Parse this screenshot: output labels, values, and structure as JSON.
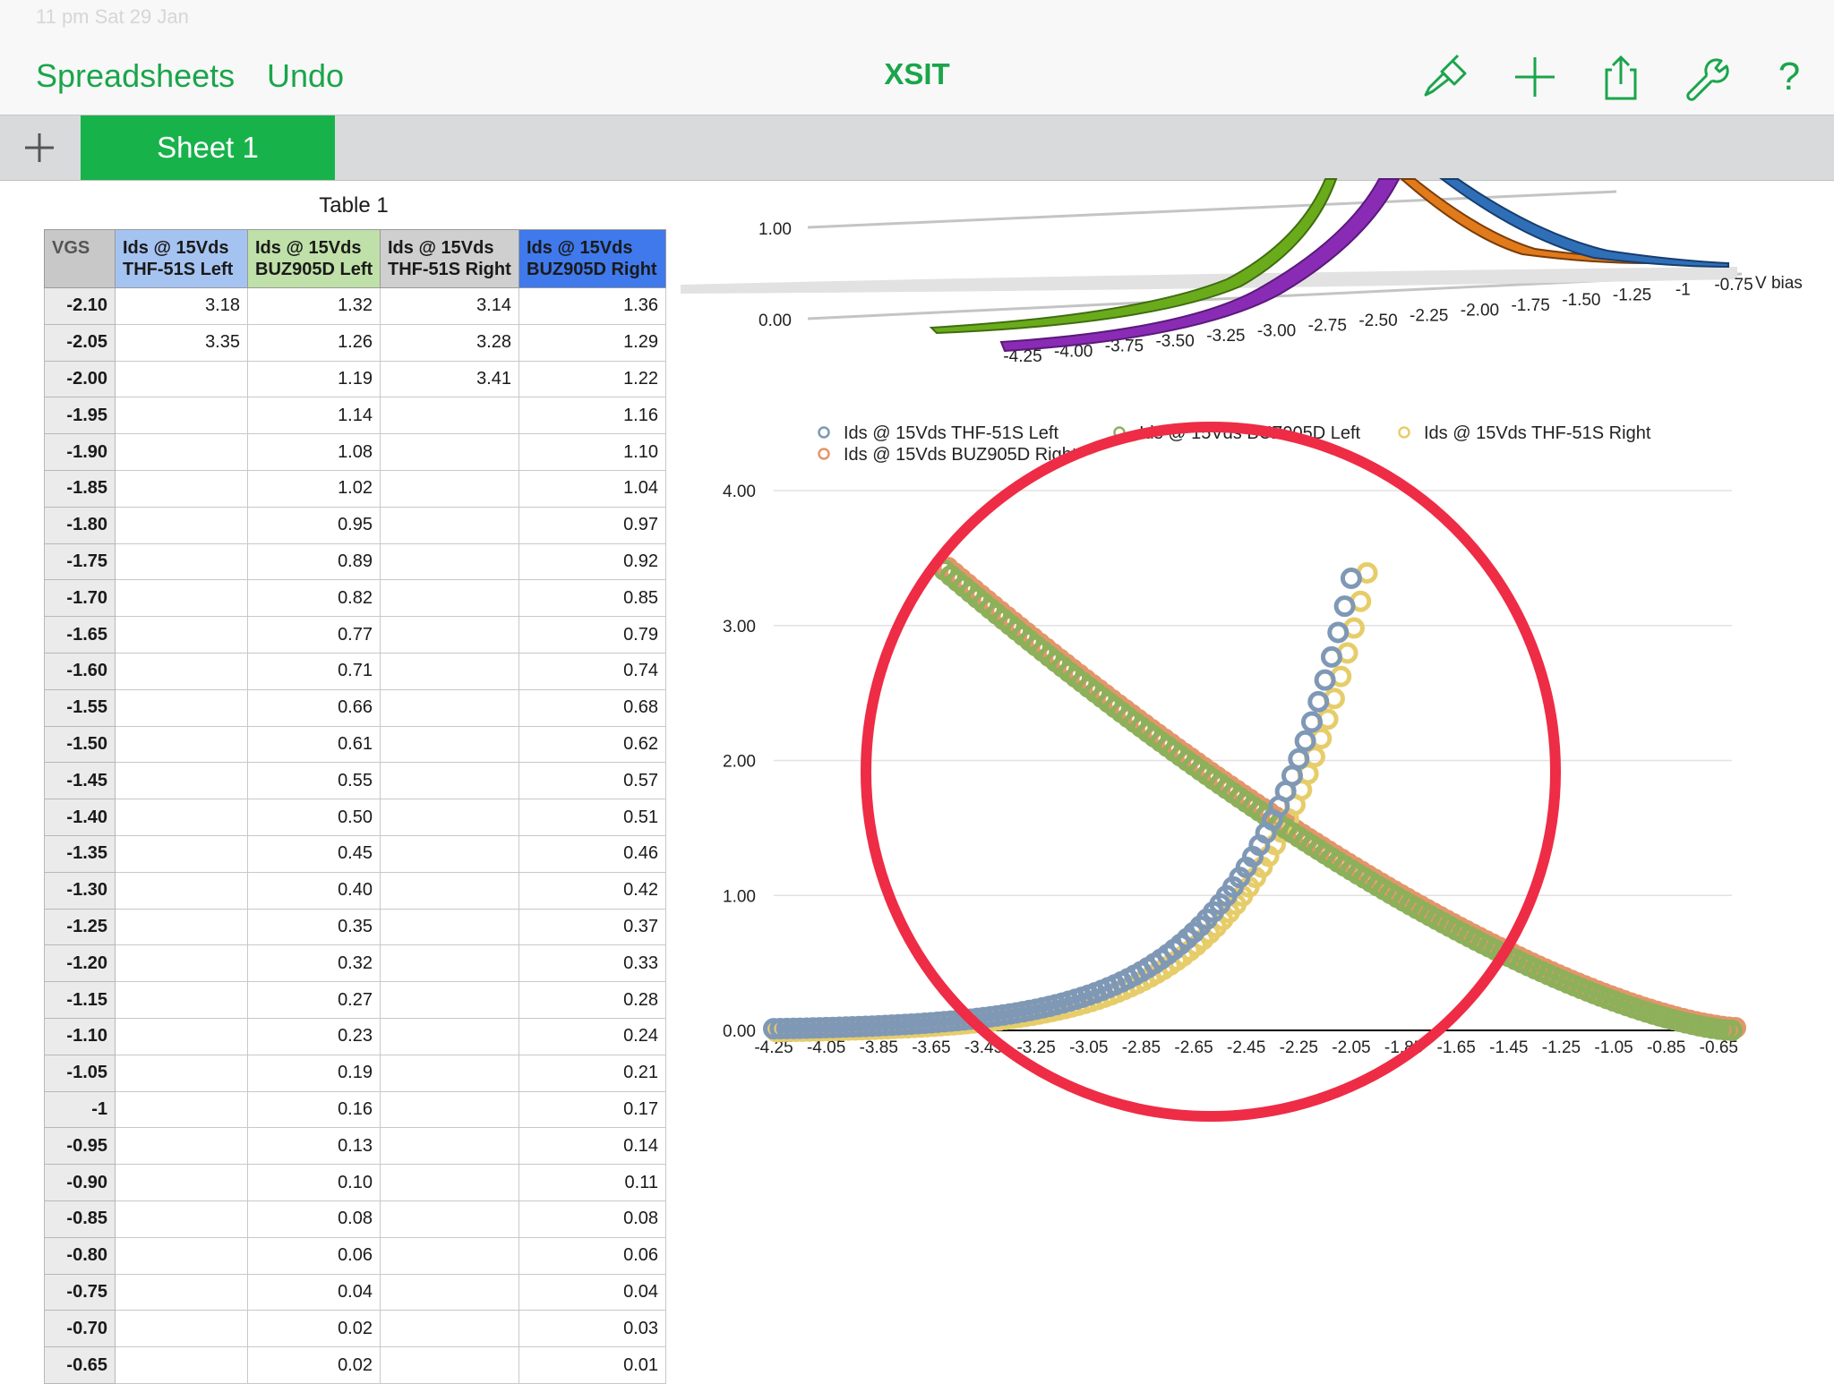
{
  "status": {
    "left_text": "11 pm  Sat 29 Jan"
  },
  "nav": {
    "back_label": "Spreadsheets",
    "undo_label": "Undo",
    "title": "XSIT",
    "icons": [
      "paintbrush-icon",
      "plus-icon",
      "share-icon",
      "wrench-icon",
      "help-icon"
    ],
    "help_glyph": "?"
  },
  "tabs": {
    "add_glyph": "+",
    "active_label": "Sheet 1"
  },
  "table": {
    "title": "Table 1",
    "headers": [
      {
        "line1": "VGS",
        "line2": ""
      },
      {
        "line1": "Ids @ 15Vds",
        "line2": "THF-51S Left"
      },
      {
        "line1": "Ids @ 15Vds",
        "line2": "BUZ905D Left"
      },
      {
        "line1": "Ids @ 15Vds",
        "line2": "THF-51S Right"
      },
      {
        "line1": "Ids @ 15Vds",
        "line2": "BUZ905D Right"
      }
    ],
    "rows": [
      [
        "-2.10",
        "3.18",
        "1.32",
        "3.14",
        "1.36"
      ],
      [
        "-2.05",
        "3.35",
        "1.26",
        "3.28",
        "1.29"
      ],
      [
        "-2.00",
        "",
        "1.19",
        "3.41",
        "1.22"
      ],
      [
        "-1.95",
        "",
        "1.14",
        "",
        "1.16"
      ],
      [
        "-1.90",
        "",
        "1.08",
        "",
        "1.10"
      ],
      [
        "-1.85",
        "",
        "1.02",
        "",
        "1.04"
      ],
      [
        "-1.80",
        "",
        "0.95",
        "",
        "0.97"
      ],
      [
        "-1.75",
        "",
        "0.89",
        "",
        "0.92"
      ],
      [
        "-1.70",
        "",
        "0.82",
        "",
        "0.85"
      ],
      [
        "-1.65",
        "",
        "0.77",
        "",
        "0.79"
      ],
      [
        "-1.60",
        "",
        "0.71",
        "",
        "0.74"
      ],
      [
        "-1.55",
        "",
        "0.66",
        "",
        "0.68"
      ],
      [
        "-1.50",
        "",
        "0.61",
        "",
        "0.62"
      ],
      [
        "-1.45",
        "",
        "0.55",
        "",
        "0.57"
      ],
      [
        "-1.40",
        "",
        "0.50",
        "",
        "0.51"
      ],
      [
        "-1.35",
        "",
        "0.45",
        "",
        "0.46"
      ],
      [
        "-1.30",
        "",
        "0.40",
        "",
        "0.42"
      ],
      [
        "-1.25",
        "",
        "0.35",
        "",
        "0.37"
      ],
      [
        "-1.20",
        "",
        "0.32",
        "",
        "0.33"
      ],
      [
        "-1.15",
        "",
        "0.27",
        "",
        "0.28"
      ],
      [
        "-1.10",
        "",
        "0.23",
        "",
        "0.24"
      ],
      [
        "-1.05",
        "",
        "0.19",
        "",
        "0.21"
      ],
      [
        "-1",
        "",
        "0.16",
        "",
        "0.17"
      ],
      [
        "-0.95",
        "",
        "0.13",
        "",
        "0.14"
      ],
      [
        "-0.90",
        "",
        "0.10",
        "",
        "0.11"
      ],
      [
        "-0.85",
        "",
        "0.08",
        "",
        "0.08"
      ],
      [
        "-0.80",
        "",
        "0.06",
        "",
        "0.06"
      ],
      [
        "-0.75",
        "",
        "0.04",
        "",
        "0.04"
      ],
      [
        "-0.70",
        "",
        "0.02",
        "",
        "0.03"
      ],
      [
        "-0.65",
        "",
        "0.02",
        "",
        "0.01"
      ]
    ]
  },
  "chart_data": [
    {
      "type": "area",
      "note_type": "3d ribbon",
      "x_tick_labels": [
        "-4.25",
        "-4.00",
        "-3.75",
        "-3.50",
        "-3.25",
        "-3.00",
        "-2.75",
        "-2.50",
        "-2.25",
        "-2.00",
        "-1.75",
        "-1.50",
        "-1.25",
        "-1",
        "-0.75"
      ],
      "axis_label": "V bias",
      "y_tick_labels": [
        "0.00",
        "1.00"
      ],
      "series_colors": [
        "#6aab1c",
        "#8a2bb5",
        "#e07a1a",
        "#2f6fb8"
      ]
    },
    {
      "type": "scatter",
      "legend": [
        {
          "name": "Ids @ 15Vds  THF-51S Left",
          "color": "#7f98b5"
        },
        {
          "name": "Ids @ 15Vds BUZ905D Left",
          "color": "#8db05a"
        },
        {
          "name": "Ids @ 15Vds  THF-51S Right",
          "color": "#e6cd6a"
        },
        {
          "name": "Ids @ 15Vds BUZ905D Right",
          "color": "#e4956a"
        }
      ],
      "legend_position": "top",
      "x_tick_labels": [
        "-4.25",
        "-4.05",
        "-3.85",
        "-3.65",
        "-3.45",
        "-3.25",
        "-3.05",
        "-2.85",
        "-2.65",
        "-2.45",
        "-2.25",
        "-2.05",
        "-1.85",
        "-1.65",
        "-1.45",
        "-1.25",
        "-1.05",
        "-0.85",
        "-0.65"
      ],
      "y_tick_labels": [
        "0.00",
        "1.00",
        "2.00",
        "3.00",
        "4.00"
      ],
      "xlim": [
        -4.25,
        -0.6
      ],
      "ylim": [
        0,
        4
      ],
      "grid": true,
      "series": [
        {
          "name": "Ids @ 15Vds  THF-51S Left",
          "x_start": -4.25,
          "x_end": -2.05,
          "shape": "rising exponential",
          "y_at_end": 3.35
        },
        {
          "name": "Ids @ 15Vds  THF-51S Right",
          "x_start": -4.25,
          "x_end": -2.0,
          "shape": "rising exponential",
          "y_at_end": 3.41
        },
        {
          "name": "Ids @ 15Vds BUZ905D Left",
          "x_start": -3.6,
          "x_end": -0.6,
          "shape": "falling",
          "y_at_start": 3.41
        },
        {
          "name": "Ids @ 15Vds BUZ905D Right",
          "x_start": -3.6,
          "x_end": -0.6,
          "shape": "falling",
          "y_at_start": 3.41
        }
      ],
      "annotation": "red circle highlighting curve crossover"
    }
  ]
}
